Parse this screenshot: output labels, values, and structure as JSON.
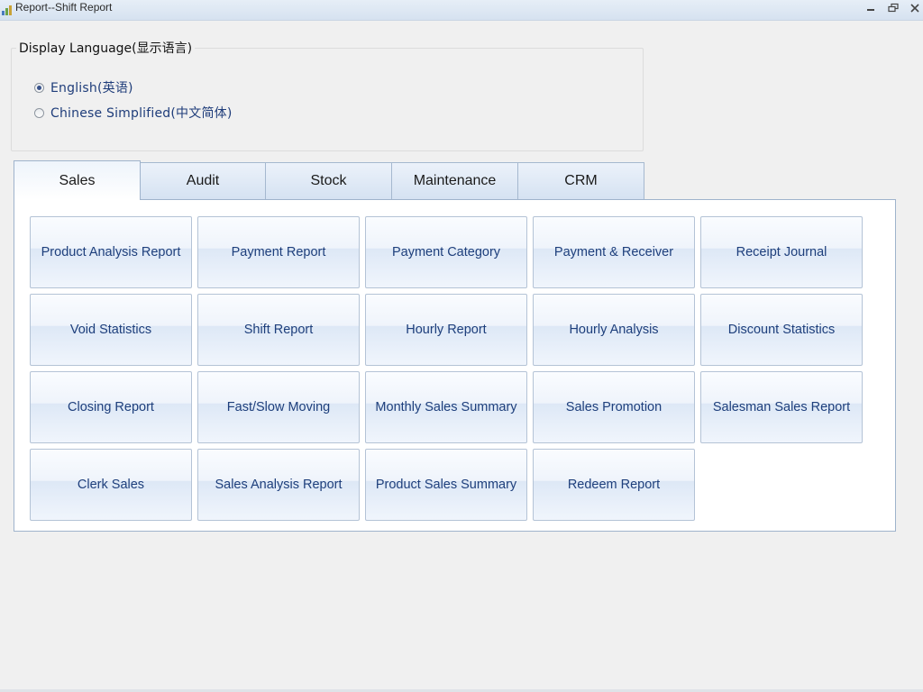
{
  "window": {
    "title": "Report--Shift Report",
    "icon": "report-chart-icon",
    "controls": [
      "minimize-icon",
      "restore-icon",
      "close-icon"
    ]
  },
  "language": {
    "legend": "Display Language(显示语言)",
    "options": [
      {
        "label": "English(英语)",
        "checked": true
      },
      {
        "label": "Chinese  Simplified(中文简体)",
        "checked": false
      }
    ]
  },
  "tabs": [
    {
      "label": "Sales",
      "active": true
    },
    {
      "label": "Audit",
      "active": false
    },
    {
      "label": "Stock",
      "active": false
    },
    {
      "label": "Maintenance",
      "active": false
    },
    {
      "label": "CRM",
      "active": false
    }
  ],
  "reports": [
    [
      "Product Analysis Report",
      "Payment Report",
      "Payment Category",
      "Payment & Receiver",
      "Receipt Journal"
    ],
    [
      "Void Statistics",
      "Shift Report",
      "Hourly Report",
      "Hourly Analysis",
      "Discount Statistics"
    ],
    [
      "Closing Report",
      "Fast/Slow Moving",
      "Monthly Sales Summary",
      "Sales Promotion",
      "Salesman Sales Report"
    ],
    [
      "Clerk Sales",
      "Sales Analysis Report",
      "Product Sales Summary",
      "Redeem Report"
    ]
  ],
  "colors": {
    "accent_text": "#1e3f7c",
    "tab_border": "#9fb3cc",
    "titlebar": "#dbe6f2"
  }
}
